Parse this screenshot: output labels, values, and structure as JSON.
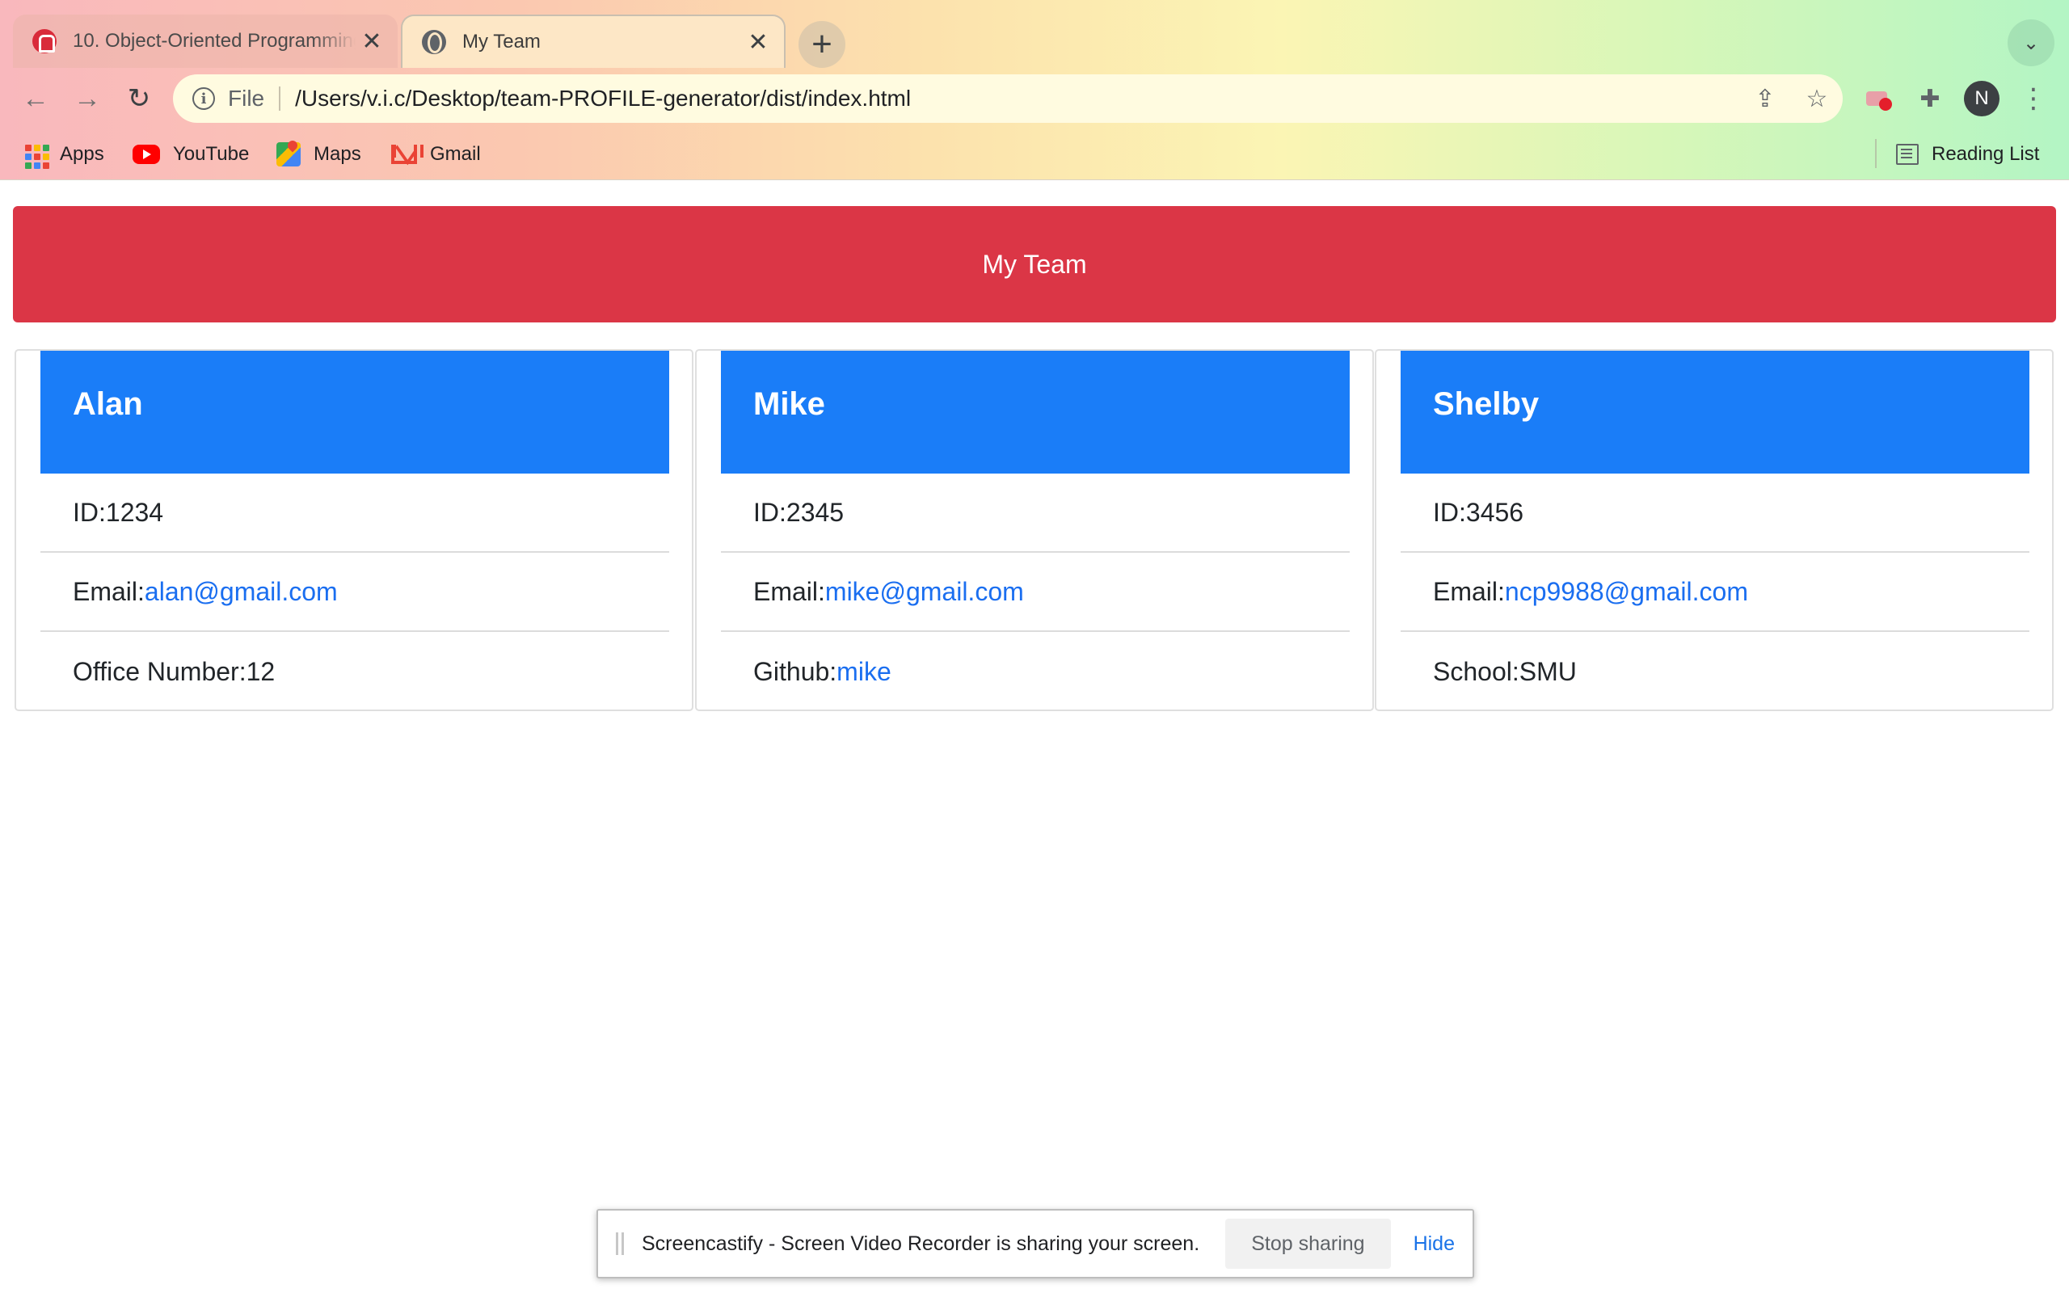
{
  "browser": {
    "tabs": [
      {
        "title": "10. Object-Oriented Programming",
        "active": false
      },
      {
        "title": "My Team",
        "active": true
      }
    ],
    "address": {
      "scheme_label": "File",
      "url": "/Users/v.i.c/Desktop/team-PROFILE-generator/dist/index.html"
    },
    "profile_initial": "N",
    "bookmarks": [
      {
        "label": "Apps",
        "icon": "apps-icon"
      },
      {
        "label": "YouTube",
        "icon": "youtube-icon"
      },
      {
        "label": "Maps",
        "icon": "maps-icon"
      },
      {
        "label": "Gmail",
        "icon": "gmail-icon"
      }
    ],
    "reading_list_label": "Reading List"
  },
  "page": {
    "header_title": "My Team",
    "team": [
      {
        "name": "Alan",
        "id_label": "ID:",
        "id": "1234",
        "email_label": "Email:",
        "email": "alan@gmail.com",
        "extra_label": "Office Number:",
        "extra": "12",
        "extra_is_link": false
      },
      {
        "name": "Mike",
        "id_label": "ID:",
        "id": "2345",
        "email_label": "Email:",
        "email": "mike@gmail.com",
        "extra_label": "Github:",
        "extra": "mike",
        "extra_is_link": true
      },
      {
        "name": "Shelby",
        "id_label": "ID:",
        "id": "3456",
        "email_label": "Email:",
        "email": "ncp9988@gmail.com",
        "extra_label": "School:",
        "extra": "SMU",
        "extra_is_link": false
      }
    ]
  },
  "share_bar": {
    "message": "Screencastify - Screen Video Recorder is sharing your screen.",
    "stop_label": "Stop sharing",
    "hide_label": "Hide"
  },
  "colors": {
    "header_red": "#db3646",
    "card_blue": "#1a7df8",
    "link_blue": "#1a6ef0"
  }
}
